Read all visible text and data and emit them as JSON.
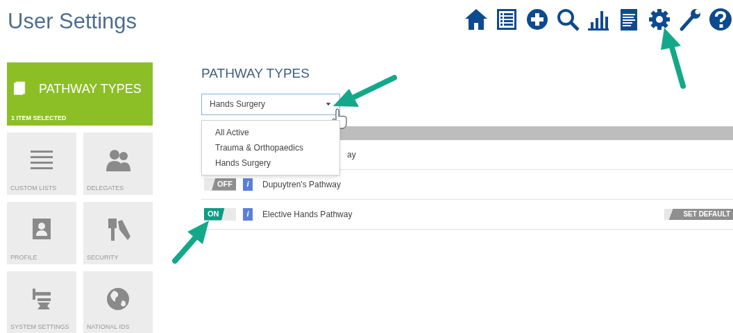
{
  "title": "User Settings",
  "tiles": [
    {
      "label": "PATHWAY TYPES",
      "caption": "1 ITEM SELECTED",
      "selected": true
    },
    {
      "label": "CUSTOM LISTS",
      "selected": false
    },
    {
      "label": "DELEGATES",
      "selected": false
    },
    {
      "label": "PROFILE",
      "selected": false
    },
    {
      "label": "SECURITY",
      "selected": false
    },
    {
      "label": "SYSTEM SETTINGS",
      "selected": false
    },
    {
      "label": "NATIONAL IDS",
      "selected": false
    }
  ],
  "heading": "PATHWAY TYPES",
  "select": {
    "value": "Hands Surgery",
    "expanded": true,
    "options": [
      "All Active",
      "Trauma & Orthopaedics",
      "Hands Surgery"
    ]
  },
  "rows": [
    {
      "name": "ay"
    },
    {
      "name": "Dupuytren's Pathway",
      "on": false,
      "off_label": "OFF",
      "info": "i"
    },
    {
      "name": "Elective Hands Pathway",
      "on": true,
      "on_label": "ON",
      "info": "i",
      "action": "SET DEFAULT"
    }
  ]
}
